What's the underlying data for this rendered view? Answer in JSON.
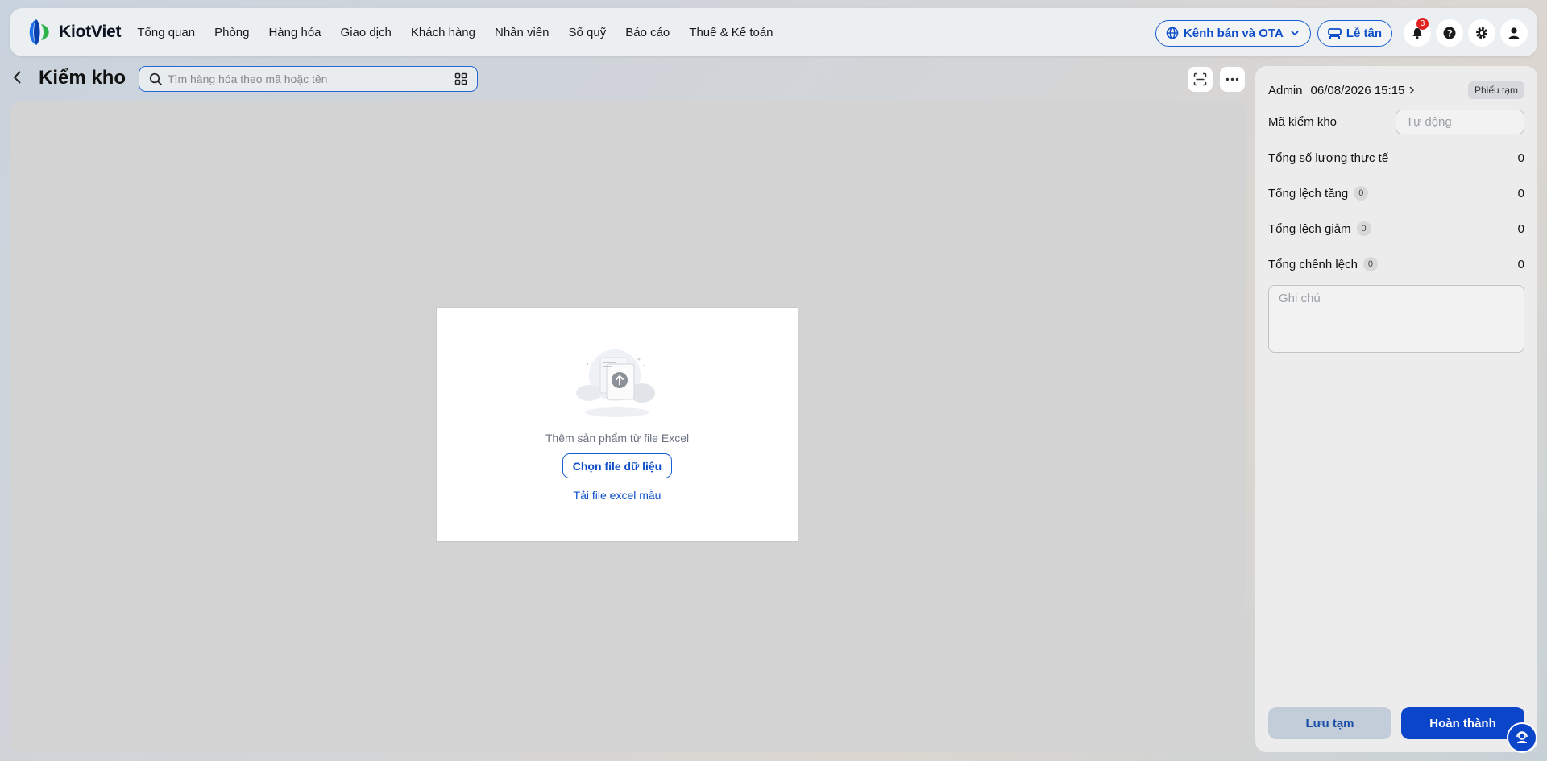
{
  "app": {
    "name": "KiotViet"
  },
  "nav": {
    "items": [
      {
        "label": "Tổng quan"
      },
      {
        "label": "Phòng"
      },
      {
        "label": "Hàng hóa"
      },
      {
        "label": "Giao dịch"
      },
      {
        "label": "Khách hàng"
      },
      {
        "label": "Nhân viên"
      },
      {
        "label": "Sổ quỹ"
      },
      {
        "label": "Báo cáo"
      },
      {
        "label": "Thuế & Kế toán"
      }
    ]
  },
  "topbar": {
    "channels_label": "Kênh bán và OTA",
    "reception_label": "Lễ tân",
    "notification_count": "3",
    "icons": [
      "globe-icon",
      "chevron-down-icon",
      "bed-icon",
      "bell-icon",
      "help-icon",
      "gear-icon",
      "user-icon"
    ]
  },
  "page": {
    "title": "Kiểm kho",
    "search_placeholder": "Tìm hàng hóa theo mã hoặc tên"
  },
  "import": {
    "text": "Thêm sản phẩm từ file Excel",
    "choose_label": "Chọn file dữ liệu",
    "sample_label": "Tải file excel mẫu"
  },
  "side": {
    "user": "Admin",
    "datetime": "06/08/2026 15:15",
    "status_tag": "Phiếu tạm",
    "code_label": "Mã kiểm kho",
    "code_placeholder": "Tự động",
    "total_actual_label": "Tổng số lượng thực tế",
    "total_actual_value": "0",
    "increase_label": "Tổng lệch tăng",
    "increase_count": "0",
    "increase_value": "0",
    "decrease_label": "Tổng lệch giảm",
    "decrease_count": "0",
    "decrease_value": "0",
    "diff_label": "Tổng chênh lệch",
    "diff_count": "0",
    "diff_value": "0",
    "note_placeholder": "Ghi chú",
    "save_label": "Lưu tạm",
    "done_label": "Hoàn thành"
  },
  "colors": {
    "accent": "#0b45c9",
    "badge": "#e02424"
  }
}
